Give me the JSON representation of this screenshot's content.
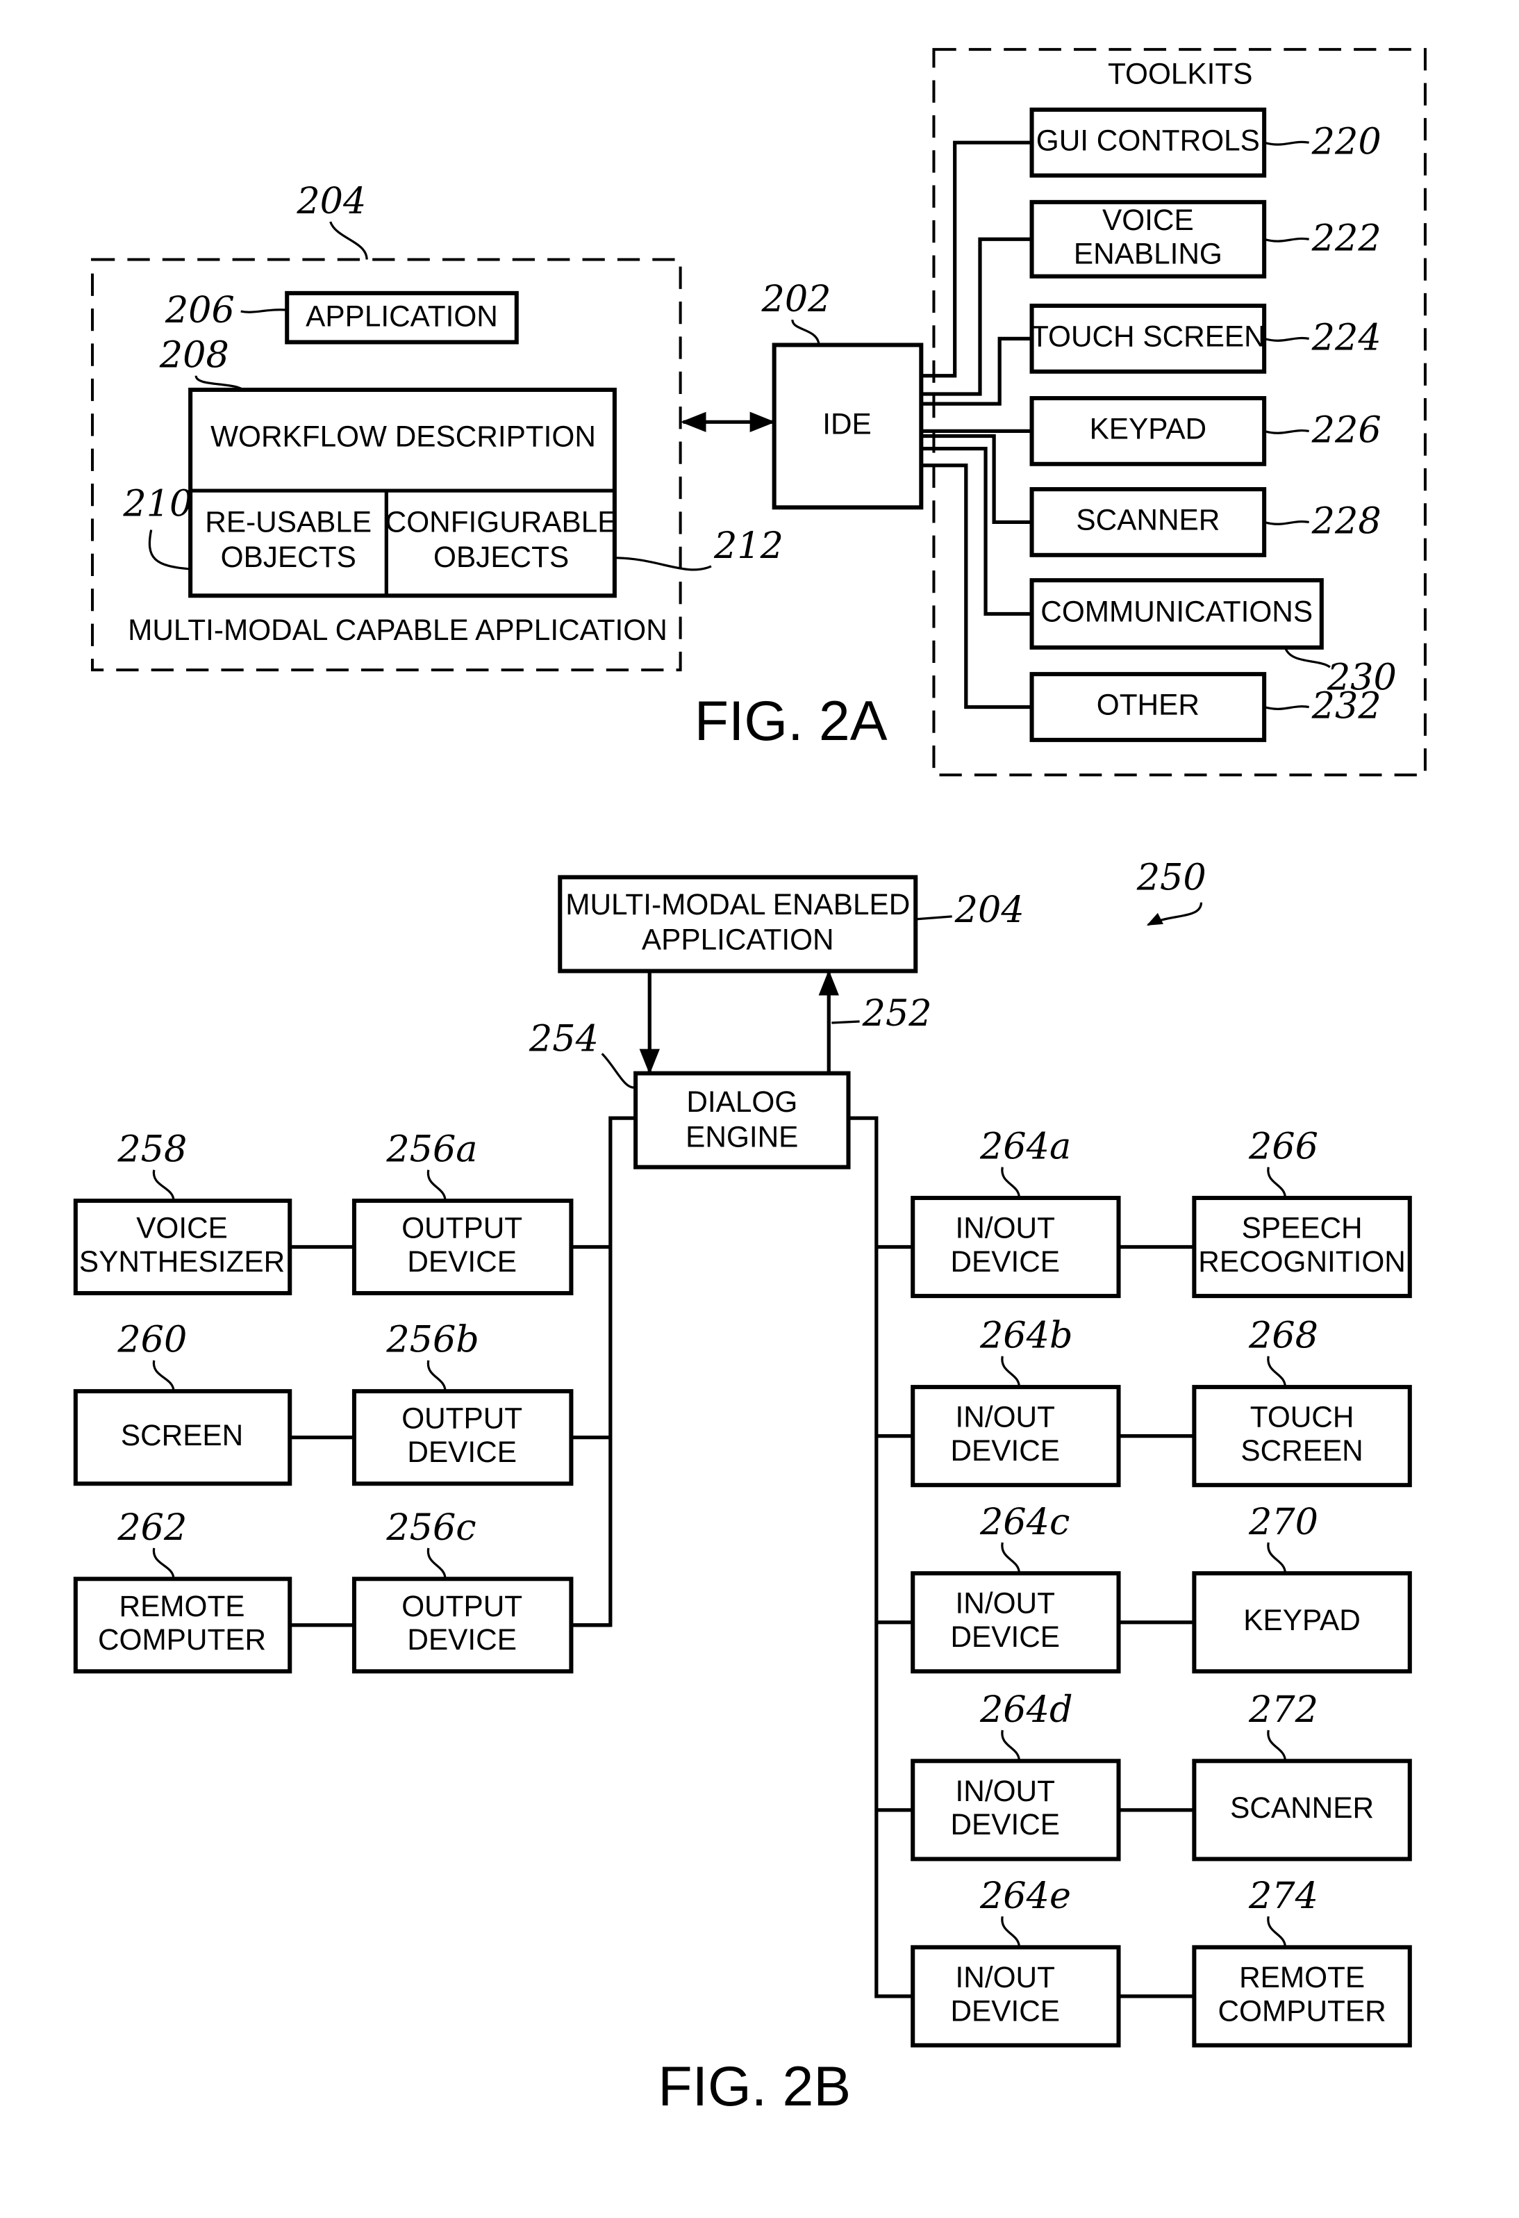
{
  "fig2a": {
    "caption": "FIG. 2A",
    "application_group": {
      "ref": "204",
      "label": "MULTI-MODAL CAPABLE APPLICATION",
      "application": {
        "ref": "206",
        "label": "APPLICATION"
      },
      "workflow": {
        "ref": "208",
        "label": "WORKFLOW DESCRIPTION"
      },
      "reusable": {
        "ref": "210",
        "line1": "RE-USABLE",
        "line2": "OBJECTS"
      },
      "configurable": {
        "ref": "212",
        "line1": "CONFIGURABLE",
        "line2": "OBJECTS"
      }
    },
    "ide": {
      "ref": "202",
      "label": "IDE"
    },
    "toolkits": {
      "title": "TOOLKITS",
      "items": [
        {
          "ref": "220",
          "line1": "GUI CONTROLS",
          "line2": ""
        },
        {
          "ref": "222",
          "line1": "VOICE",
          "line2": "ENABLING"
        },
        {
          "ref": "224",
          "line1": "TOUCH SCREEN",
          "line2": ""
        },
        {
          "ref": "226",
          "line1": "KEYPAD",
          "line2": ""
        },
        {
          "ref": "228",
          "line1": "SCANNER",
          "line2": ""
        },
        {
          "ref": "230",
          "line1": "COMMUNICATIONS",
          "line2": ""
        },
        {
          "ref": "232",
          "line1": "OTHER",
          "line2": ""
        }
      ]
    }
  },
  "fig2b": {
    "caption": "FIG. 2B",
    "ref": "250",
    "app": {
      "ref": "204",
      "line1": "MULTI-MODAL ENABLED",
      "line2": "APPLICATION"
    },
    "arrow_ref": "252",
    "engine": {
      "ref": "254",
      "line1": "DIALOG",
      "line2": "ENGINE"
    },
    "outputs": [
      {
        "ref": "256a",
        "line1": "OUTPUT",
        "line2": "DEVICE",
        "peer": {
          "ref": "258",
          "line1": "VOICE",
          "line2": "SYNTHESIZER"
        }
      },
      {
        "ref": "256b",
        "line1": "OUTPUT",
        "line2": "DEVICE",
        "peer": {
          "ref": "260",
          "line1": "SCREEN",
          "line2": ""
        }
      },
      {
        "ref": "256c",
        "line1": "OUTPUT",
        "line2": "DEVICE",
        "peer": {
          "ref": "262",
          "line1": "REMOTE",
          "line2": "COMPUTER"
        }
      }
    ],
    "inouts": [
      {
        "ref": "264a",
        "line1": "IN/OUT",
        "line2": "DEVICE",
        "peer": {
          "ref": "266",
          "line1": "SPEECH",
          "line2": "RECOGNITION"
        }
      },
      {
        "ref": "264b",
        "line1": "IN/OUT",
        "line2": "DEVICE",
        "peer": {
          "ref": "268",
          "line1": "TOUCH",
          "line2": "SCREEN"
        }
      },
      {
        "ref": "264c",
        "line1": "IN/OUT",
        "line2": "DEVICE",
        "peer": {
          "ref": "270",
          "line1": "KEYPAD",
          "line2": ""
        }
      },
      {
        "ref": "264d",
        "line1": "IN/OUT",
        "line2": "DEVICE",
        "peer": {
          "ref": "272",
          "line1": "SCANNER",
          "line2": ""
        }
      },
      {
        "ref": "264e",
        "line1": "IN/OUT",
        "line2": "DEVICE",
        "peer": {
          "ref": "274",
          "line1": "REMOTE",
          "line2": "COMPUTER"
        }
      }
    ]
  }
}
